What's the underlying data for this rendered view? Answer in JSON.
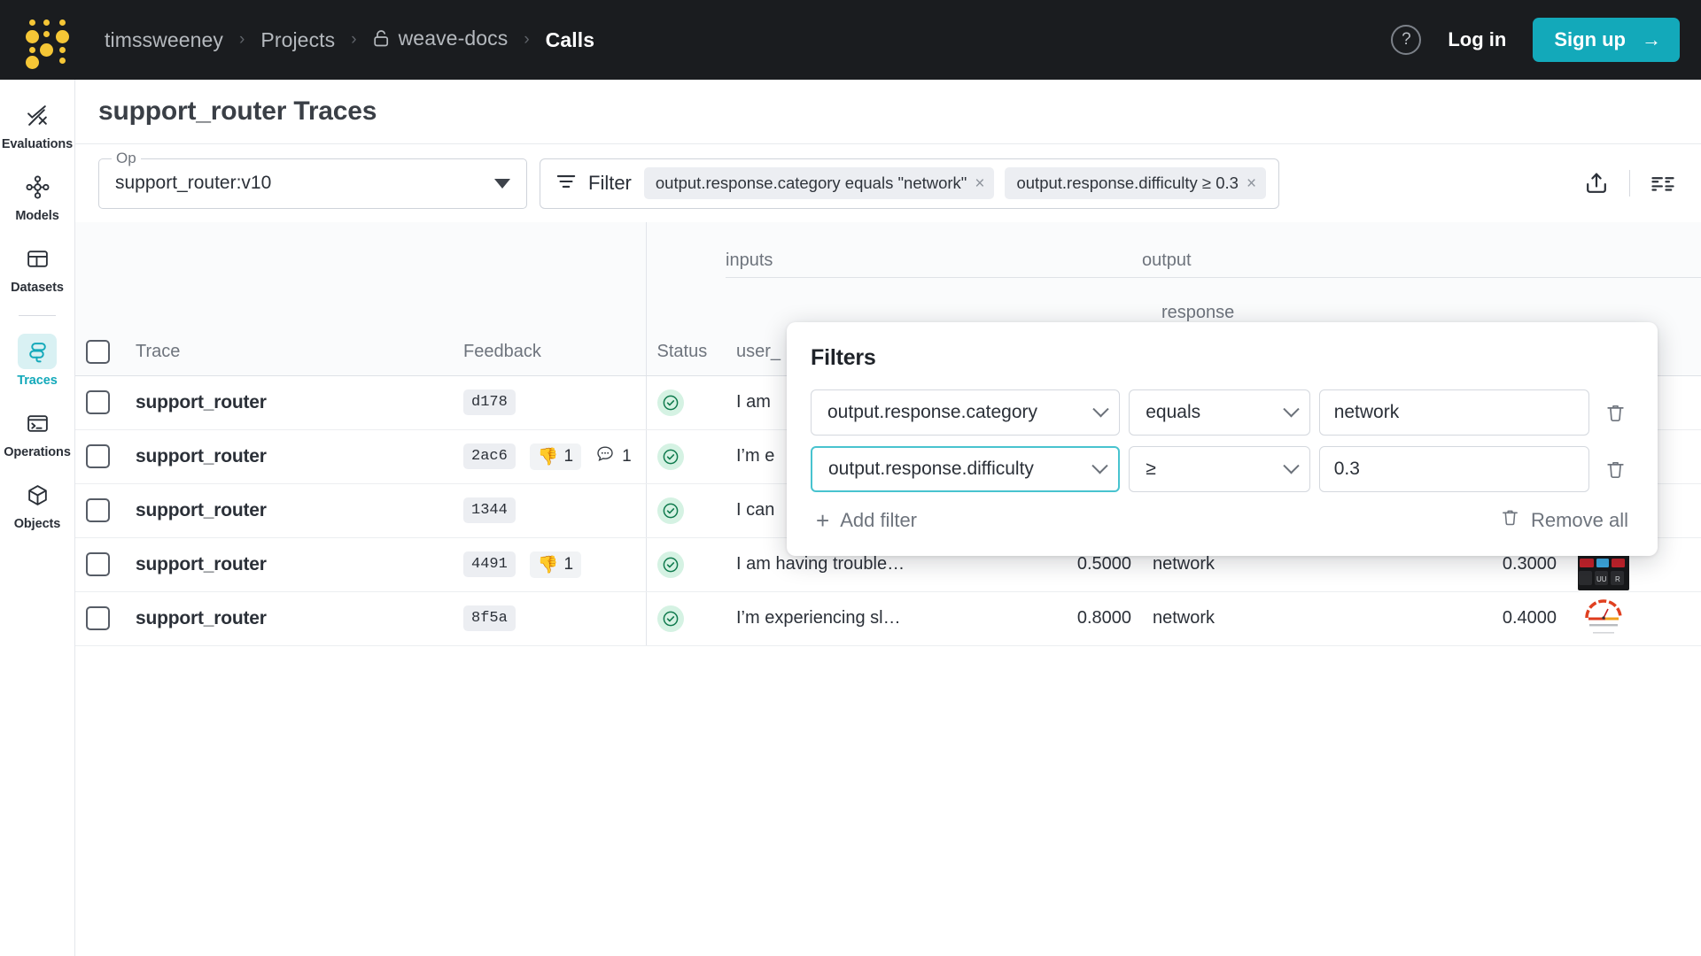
{
  "topbar": {
    "logo": "wandb-logo",
    "breadcrumb": [
      {
        "label": "timssweeney",
        "current": false,
        "lock": false
      },
      {
        "label": "Projects",
        "current": false,
        "lock": false
      },
      {
        "label": "weave-docs",
        "current": false,
        "lock": true
      },
      {
        "label": "Calls",
        "current": true,
        "lock": false
      }
    ],
    "separator": "›",
    "help_label": "?",
    "login_label": "Log in",
    "signup_label": "Sign up",
    "signup_arrow": "→",
    "signup_color": "#13a9ba"
  },
  "sidebar": {
    "items": [
      {
        "label": "Evaluations",
        "icon": "evaluations-icon",
        "active": false
      },
      {
        "label": "Models",
        "icon": "models-icon",
        "active": false
      },
      {
        "label": "Datasets",
        "icon": "datasets-icon",
        "active": false
      },
      {
        "label": "Traces",
        "icon": "traces-icon",
        "active": true
      },
      {
        "label": "Operations",
        "icon": "operations-icon",
        "active": false
      },
      {
        "label": "Objects",
        "icon": "objects-icon",
        "active": false
      }
    ],
    "active_color": "#13a9ba"
  },
  "page": {
    "title": "support_router Traces"
  },
  "toolbar": {
    "op_legend": "Op",
    "op_value": "support_router:v10",
    "filter_label": "Filter",
    "filter_icon": "filter-icon",
    "chips": [
      {
        "text": "output.response.category equals \"network\"",
        "close": "×"
      },
      {
        "text": "output.response.difficulty ≥ 0.3",
        "close": "×"
      }
    ],
    "export_icon": "export-icon",
    "columns_icon": "column-settings-icon"
  },
  "table": {
    "group_headers": [
      {
        "label": "inputs"
      },
      {
        "label": "output"
      }
    ],
    "sub_headers": [
      {
        "label": "response"
      }
    ],
    "columns": [
      "Trace",
      "Feedback",
      "Status",
      "user_"
    ],
    "rows": [
      {
        "trace": "support_router",
        "id": "d178",
        "feedback": {
          "thumbsdown": null,
          "notes": null
        },
        "status": "success",
        "input": "I am ",
        "num1": "",
        "category": "",
        "num2": "",
        "thumb": ""
      },
      {
        "trace": "support_router",
        "id": "2ac6",
        "feedback": {
          "thumbsdown": "1",
          "notes": "1"
        },
        "status": "success",
        "input": "I’m e",
        "num1": "",
        "category": "",
        "num2": "",
        "thumb": ""
      },
      {
        "trace": "support_router",
        "id": "1344",
        "feedback": {
          "thumbsdown": null,
          "notes": null
        },
        "status": "success",
        "input": "I can",
        "num1": "",
        "category": "",
        "num2": "",
        "thumb": ""
      },
      {
        "trace": "support_router",
        "id": "4491",
        "feedback": {
          "thumbsdown": "1",
          "notes": null
        },
        "status": "success",
        "input": "I am having trouble…",
        "num1": "0.5000",
        "category": "network",
        "num2": "0.3000",
        "thumb": "keyboard-photo"
      },
      {
        "trace": "support_router",
        "id": "8f5a",
        "feedback": {
          "thumbsdown": null,
          "notes": null
        },
        "status": "success",
        "input": "I’m experiencing sl…",
        "num1": "0.8000",
        "category": "network",
        "num2": "0.4000",
        "thumb": "gauge-chart"
      }
    ]
  },
  "filters_popover": {
    "title": "Filters",
    "rows": [
      {
        "field": "output.response.category",
        "operator": "equals",
        "value": "network",
        "focused": false
      },
      {
        "field": "output.response.difficulty",
        "operator": "≥",
        "value": "0.3",
        "focused": true
      }
    ],
    "add_filter_label": "Add filter",
    "add_filter_icon": "plus-icon",
    "remove_all_label": "Remove all",
    "remove_all_icon": "trash-icon",
    "delete_icon": "trash-icon",
    "focus_color": "#48c3cf"
  }
}
